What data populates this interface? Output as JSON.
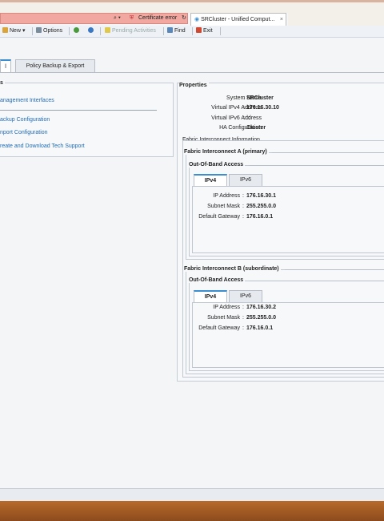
{
  "browser": {
    "security_warning": "Certificate error",
    "tab_title": "SRCluster - Unified Comput...",
    "tab_close": "×"
  },
  "toolbar": {
    "new_label": "New ▾",
    "options_label": "Options",
    "pending_label": "Pending Activities",
    "find_label": "Find",
    "exit_label": "Exit"
  },
  "tabs": {
    "active_fragment": "l",
    "policy_backup": "Policy Backup & Export"
  },
  "left_panel": {
    "heading_fragment": "s",
    "links": [
      "anagement Interfaces",
      "ackup Configuration",
      "nport Configuration",
      "reate and Download Tech Support"
    ]
  },
  "properties": {
    "heading": "Properties",
    "rows": [
      {
        "label": "System Name",
        "value": "SRCluster"
      },
      {
        "label": "Virtual IPv4 Address",
        "value": "176.16.30.10"
      },
      {
        "label": "Virtual IPv6 Address",
        "value": "::"
      },
      {
        "label": "HA Configuration",
        "value": "Cluster"
      }
    ],
    "separator": ":",
    "fi_info_heading": "Fabric Interconnect Information"
  },
  "fi_a": {
    "heading": "Fabric Interconnect A (primary)",
    "oob_heading": "Out-Of-Band Access",
    "tab_ipv4": "IPv4",
    "tab_ipv6": "IPv6",
    "rows": [
      {
        "label": "IP Address",
        "value": "176.16.30.1"
      },
      {
        "label": "Subnet Mask",
        "value": "255.255.0.0"
      },
      {
        "label": "Default Gateway",
        "value": "176.16.0.1"
      }
    ]
  },
  "fi_b": {
    "heading": "Fabric Interconnect B (subordinate)",
    "oob_heading": "Out-Of-Band Access",
    "tab_ipv4": "IPv4",
    "tab_ipv6": "IPv6",
    "rows": [
      {
        "label": "IP Address",
        "value": "176.16.30.2"
      },
      {
        "label": "Subnet Mask",
        "value": "255.255.0.0"
      },
      {
        "label": "Default Gateway",
        "value": "176.16.0.1"
      }
    ]
  },
  "colors": {
    "link": "#1f6bb5",
    "tab_accent": "#3b8fd0",
    "address_bar_error": "#f0a8a0",
    "taskbar": "#a35a22"
  },
  "icons": {
    "search": "search-icon",
    "cert_error": "shield-error-icon",
    "refresh": "refresh-icon",
    "ucs_tab": "ucs-icon",
    "new": "new-icon",
    "options": "options-icon",
    "help": "help-icon",
    "info": "info-icon",
    "warning": "warning-icon",
    "find": "find-icon",
    "exit": "exit-icon"
  }
}
